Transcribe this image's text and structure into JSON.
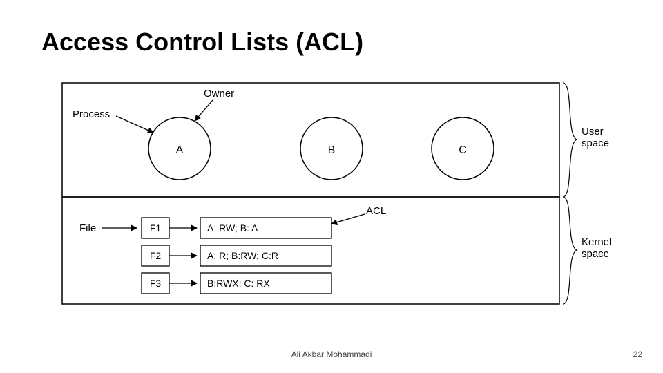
{
  "title": "Access Control Lists (ACL)",
  "footer": {
    "author": "Ali Akbar Mohammadi",
    "page": "22"
  },
  "diagram": {
    "labels": {
      "process": "Process",
      "owner": "Owner",
      "file": "File",
      "acl": "ACL",
      "user_space": "User\nspace",
      "kernel_space": "Kernel\nspace"
    },
    "circles": {
      "a": "A",
      "b": "B",
      "c": "C"
    },
    "files": {
      "f1": "F1",
      "f2": "F2",
      "f3": "F3"
    },
    "acls": {
      "row1": "A: RW;   B: A",
      "row2": "A: R;   B:RW;   C:R",
      "row3": "B:RWX;   C: RX"
    }
  }
}
